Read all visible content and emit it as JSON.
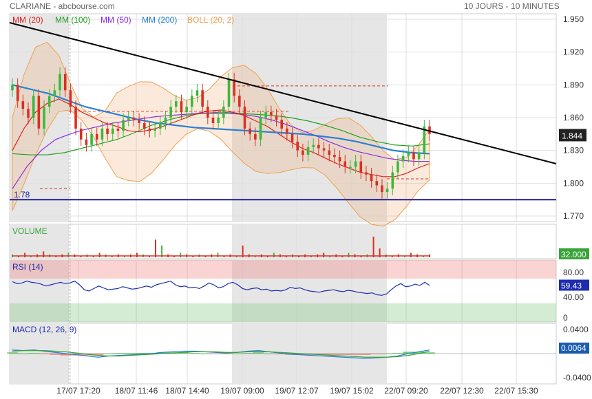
{
  "header": {
    "title": "CLARIANE - abcbourse.com",
    "period": "10 JOURS - 10 MINUTES"
  },
  "legend": [
    {
      "label": "MM (20)",
      "color": "#e02020"
    },
    {
      "label": "MM (100)",
      "color": "#20a020"
    },
    {
      "label": "MM (50)",
      "color": "#8a2be2"
    },
    {
      "label": "MM (200)",
      "color": "#2a7fd4"
    },
    {
      "label": "BOLL (20, 2)",
      "color": "#f0a050"
    }
  ],
  "colors": {
    "up": "#3cb83c",
    "down": "#d83020",
    "trend": "#000000",
    "support": "#1c1c9c",
    "rsi_line": "#1c2cb0",
    "shade": "#e6e6e6"
  },
  "chart_data": [
    {
      "type": "line",
      "name": "price",
      "ylim": [
        1.765,
        1.955
      ],
      "y_ticks": [
        "1.950",
        "1.920",
        "1.890",
        "1.860",
        "1.830",
        "1.800",
        "1.770"
      ],
      "x_ticks": [
        "17/07 17:20",
        "18/07 11:46",
        "18/07 14:40",
        "19/07 09:00",
        "19/07 12:07",
        "19/07 15:02",
        "22/07 09:20",
        "22/07 12:30",
        "22/07 15:30"
      ],
      "last_price": "1.844",
      "support": {
        "value": 1.785,
        "label": "1.78"
      },
      "resistance_dashed": [
        1.889,
        1.866,
        1.795,
        1.804
      ],
      "trendline": [
        [
          0,
          1.948
        ],
        [
          100,
          1.821
        ]
      ],
      "candles_close": [
        1.89,
        1.875,
        1.868,
        1.86,
        1.88,
        1.85,
        1.87,
        1.88,
        1.885,
        1.9,
        1.885,
        1.87,
        1.85,
        1.84,
        1.835,
        1.845,
        1.84,
        1.85,
        1.845,
        1.85,
        1.848,
        1.858,
        1.86,
        1.858,
        1.855,
        1.85,
        1.848,
        1.85,
        1.855,
        1.86,
        1.87,
        1.875,
        1.865,
        1.87,
        1.88,
        1.885,
        1.87,
        1.86,
        1.855,
        1.86,
        1.87,
        1.895,
        1.88,
        1.87,
        1.85,
        1.845,
        1.84,
        1.86,
        1.865,
        1.862,
        1.858,
        1.85,
        1.845,
        1.838,
        1.83,
        1.826,
        1.833,
        1.835,
        1.832,
        1.83,
        1.826,
        1.824,
        1.82,
        1.815,
        1.815,
        1.82,
        1.81,
        1.808,
        1.802,
        1.798,
        1.792,
        1.795,
        1.81,
        1.82,
        1.825,
        1.828,
        1.822,
        1.828,
        1.852,
        1.845
      ],
      "mm20": [
        1.83,
        1.85,
        1.865,
        1.873,
        1.877,
        1.872,
        1.865,
        1.86,
        1.855,
        1.852,
        1.848,
        1.847,
        1.849,
        1.852,
        1.856,
        1.86,
        1.864,
        1.866,
        1.867,
        1.865,
        1.862,
        1.857,
        1.852,
        1.845,
        1.838,
        1.832,
        1.828,
        1.823,
        1.818,
        1.814,
        1.81,
        1.808,
        1.806,
        1.806,
        1.809,
        1.814,
        1.818
      ],
      "mm50": [
        1.795,
        1.815,
        1.83,
        1.84,
        1.845,
        1.849,
        1.852,
        1.855,
        1.857,
        1.859,
        1.861,
        1.862,
        1.863,
        1.864,
        1.864,
        1.864,
        1.863,
        1.861,
        1.858,
        1.854,
        1.849,
        1.844,
        1.838,
        1.833,
        1.829,
        1.826,
        1.823,
        1.821,
        1.82,
        1.82
      ],
      "mm100": [
        1.827,
        1.826,
        1.826,
        1.828,
        1.832,
        1.836,
        1.84,
        1.846,
        1.853,
        1.858,
        1.862,
        1.864,
        1.865,
        1.864,
        1.863,
        1.862,
        1.86,
        1.857,
        1.853,
        1.848,
        1.842,
        1.838,
        1.835,
        1.834,
        1.836
      ],
      "mm200": [
        1.89,
        1.886,
        1.882,
        1.876,
        1.87,
        1.866,
        1.862,
        1.858,
        1.855,
        1.853,
        1.851,
        1.85,
        1.849,
        1.848,
        1.847,
        1.846,
        1.845,
        1.843,
        1.841,
        1.838,
        1.834,
        1.83,
        1.828,
        1.827
      ]
    },
    {
      "type": "bar",
      "name": "VOLUME",
      "ylim": [
        0,
        32000
      ],
      "last_value": "32.000",
      "values": [
        2,
        1,
        3,
        1,
        2,
        4,
        2,
        1,
        2,
        3,
        2,
        1,
        2,
        1,
        3,
        2,
        1,
        2,
        1,
        2,
        3,
        2,
        1,
        12,
        8,
        2,
        1,
        3,
        2,
        1,
        2,
        1,
        2,
        3,
        1,
        2,
        1,
        8,
        2,
        1,
        2,
        1,
        3,
        2,
        1,
        2,
        1,
        2,
        1,
        2,
        3,
        1,
        2,
        1,
        3,
        2,
        1,
        2,
        14,
        6,
        2,
        1,
        2,
        1,
        3,
        2,
        1,
        2
      ]
    },
    {
      "type": "line",
      "name": "RSI (14)",
      "ylim": [
        0,
        100
      ],
      "y_ticks": [
        "80.00",
        "40.00",
        "0"
      ],
      "last_value": "59.43",
      "values": [
        65,
        62,
        63,
        66,
        64,
        63,
        61,
        58,
        60,
        62,
        64,
        62,
        63,
        66,
        60,
        52,
        50,
        54,
        58,
        55,
        52,
        53,
        54,
        57,
        55,
        53,
        54,
        56,
        58,
        56,
        60,
        62,
        64,
        66,
        60,
        57,
        58,
        55,
        56,
        54,
        58,
        63,
        60,
        55,
        57,
        62,
        64,
        60,
        54,
        52,
        54,
        55,
        52,
        53,
        50,
        51,
        50,
        52,
        56,
        54,
        55,
        52,
        50,
        49,
        48,
        50,
        51,
        52,
        50,
        49,
        51,
        50,
        48,
        47,
        46,
        47,
        44,
        43,
        45,
        52,
        58,
        62,
        57,
        58,
        61,
        59,
        64,
        59
      ]
    },
    {
      "type": "area",
      "name": "MACD (12, 26, 9)",
      "ylim": [
        -0.05,
        0.05
      ],
      "y_ticks": [
        "0.0400",
        "-0.0400"
      ],
      "last_value": "0.0064",
      "macd": [
        0.006,
        0.005,
        0.006,
        0.004,
        0.002,
        0.0,
        -0.002,
        -0.004,
        -0.006,
        -0.004,
        -0.003,
        -0.002,
        -0.001,
        0.0,
        0.002,
        0.003,
        0.004,
        0.004,
        0.003,
        0.002,
        0.001,
        0.002,
        0.004,
        0.005,
        0.003,
        0.001,
        -0.001,
        -0.002,
        -0.003,
        -0.004,
        -0.005,
        -0.006,
        -0.007,
        -0.008,
        -0.007,
        -0.006,
        -0.004,
        0.0,
        0.003,
        0.006
      ],
      "signal": [
        0.004,
        0.005,
        0.005,
        0.005,
        0.004,
        0.003,
        0.001,
        -0.001,
        -0.003,
        -0.004,
        -0.004,
        -0.003,
        -0.002,
        -0.001,
        0.0,
        0.001,
        0.002,
        0.003,
        0.003,
        0.003,
        0.002,
        0.002,
        0.003,
        0.003,
        0.003,
        0.002,
        0.001,
        0.0,
        -0.001,
        -0.002,
        -0.003,
        -0.004,
        -0.005,
        -0.006,
        -0.006,
        -0.006,
        -0.005,
        -0.003,
        0.0,
        0.004
      ]
    }
  ],
  "panels": {
    "volume_title": "VOLUME",
    "rsi_title": "RSI (14)",
    "macd_title": "MACD (12, 26, 9)"
  }
}
